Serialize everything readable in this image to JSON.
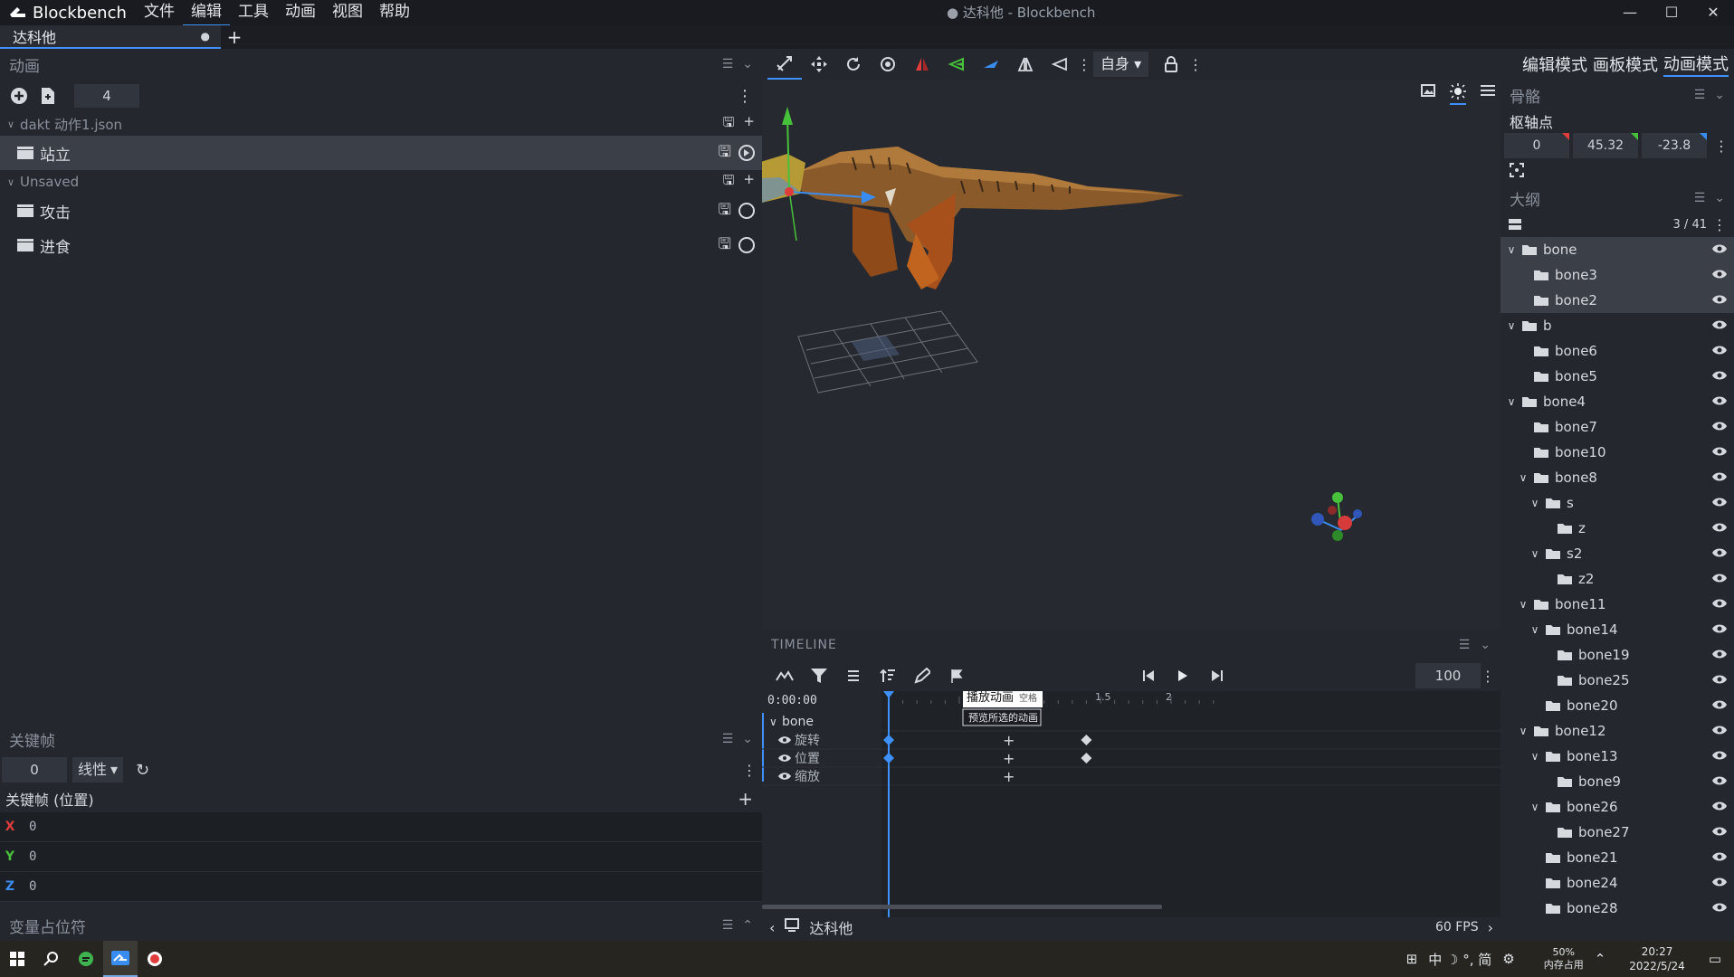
{
  "app": {
    "name": "Blockbench",
    "window_title": "● 达科他 - Blockbench",
    "menu": [
      "文件",
      "编辑",
      "工具",
      "动画",
      "视图",
      "帮助"
    ],
    "active_menu": "编辑",
    "tab_name": "达科他",
    "tab_dot": "●",
    "add_tab": "+",
    "minimize": "—",
    "maximize": "☐",
    "close": "✕"
  },
  "animations_panel": {
    "title": "动画",
    "count": "4",
    "file_group": "dakt 动作1.json",
    "unsaved_group": "Unsaved",
    "items": [
      {
        "label": "站立",
        "group": "file",
        "selected": true,
        "playing": true
      },
      {
        "label": "攻击",
        "group": "unsaved",
        "selected": false,
        "playing": false
      },
      {
        "label": "进食",
        "group": "unsaved",
        "selected": false,
        "playing": false
      }
    ]
  },
  "keyframe_panel": {
    "title": "关键帧",
    "time_value": "0",
    "interpolation": "线性",
    "section_title": "关键帧 (位置)",
    "axes": [
      {
        "axis": "X",
        "value": "0",
        "color": "#e03c3c"
      },
      {
        "axis": "Y",
        "value": "0",
        "color": "#47c13b"
      },
      {
        "axis": "Z",
        "value": "0",
        "color": "#3a8df0"
      }
    ]
  },
  "variables_panel": {
    "title": "变量占位符"
  },
  "viewport": {
    "space_select": "自身"
  },
  "timeline": {
    "title": "TIMELINE",
    "current_time": "0:00:00",
    "fps_field": "100",
    "ruler_labels": [
      "1.5",
      "2"
    ],
    "tooltip_title": "播放动画",
    "tooltip_key": "空格",
    "tooltip_desc": "预览所选的动画",
    "bone": "bone",
    "channels": [
      {
        "label": "旋转",
        "keyframes": [
          0,
          1.4
        ]
      },
      {
        "label": "位置",
        "keyframes": [
          0,
          1.4
        ]
      },
      {
        "label": "缩放",
        "keyframes": []
      }
    ],
    "animation_name": "达科他",
    "fps_label": "60 FPS"
  },
  "right_panel": {
    "modes": [
      "编辑模式",
      "画板模式",
      "动画模式"
    ],
    "active_mode": "动画模式",
    "bones_title": "骨骼",
    "pivot_label": "枢轴点",
    "pivot": [
      "0",
      "45.32",
      "-23.8"
    ],
    "outliner_title": "大纲",
    "outliner_count": "3 / 41",
    "tree": [
      {
        "name": "bone",
        "depth": 0,
        "expanded": true,
        "selected": true
      },
      {
        "name": "bone3",
        "depth": 1,
        "expanded": null,
        "selected": true
      },
      {
        "name": "bone2",
        "depth": 1,
        "expanded": null,
        "selected": true
      },
      {
        "name": "b",
        "depth": 0,
        "expanded": true,
        "selected": false
      },
      {
        "name": "bone6",
        "depth": 1,
        "expanded": null,
        "selected": false
      },
      {
        "name": "bone5",
        "depth": 1,
        "expanded": null,
        "selected": false
      },
      {
        "name": "bone4",
        "depth": 0,
        "expanded": true,
        "selected": false
      },
      {
        "name": "bone7",
        "depth": 1,
        "expanded": null,
        "selected": false
      },
      {
        "name": "bone10",
        "depth": 1,
        "expanded": null,
        "selected": false
      },
      {
        "name": "bone8",
        "depth": 1,
        "expanded": true,
        "selected": false
      },
      {
        "name": "s",
        "depth": 2,
        "expanded": true,
        "selected": false
      },
      {
        "name": "z",
        "depth": 3,
        "expanded": null,
        "selected": false
      },
      {
        "name": "s2",
        "depth": 2,
        "expanded": true,
        "selected": false
      },
      {
        "name": "z2",
        "depth": 3,
        "expanded": null,
        "selected": false
      },
      {
        "name": "bone11",
        "depth": 1,
        "expanded": true,
        "selected": false
      },
      {
        "name": "bone14",
        "depth": 2,
        "expanded": true,
        "selected": false
      },
      {
        "name": "bone19",
        "depth": 3,
        "expanded": null,
        "selected": false
      },
      {
        "name": "bone25",
        "depth": 3,
        "expanded": null,
        "selected": false
      },
      {
        "name": "bone20",
        "depth": 2,
        "expanded": null,
        "selected": false
      },
      {
        "name": "bone12",
        "depth": 1,
        "expanded": true,
        "selected": false
      },
      {
        "name": "bone13",
        "depth": 2,
        "expanded": true,
        "selected": false
      },
      {
        "name": "bone9",
        "depth": 3,
        "expanded": null,
        "selected": false
      },
      {
        "name": "bone26",
        "depth": 2,
        "expanded": true,
        "selected": false
      },
      {
        "name": "bone27",
        "depth": 3,
        "expanded": null,
        "selected": false
      },
      {
        "name": "bone21",
        "depth": 2,
        "expanded": null,
        "selected": false
      },
      {
        "name": "bone24",
        "depth": 2,
        "expanded": null,
        "selected": false
      },
      {
        "name": "bone28",
        "depth": 2,
        "expanded": null,
        "selected": false
      }
    ]
  },
  "taskbar": {
    "tray_text": "中 ☽ °, 简",
    "memory_percent": "50%",
    "memory_label": "内存占用",
    "time": "20:27",
    "date": "2022/5/24"
  },
  "colors": {
    "accent": "#3e90ff",
    "x_axis": "#e03c3c",
    "y_axis": "#47c13b",
    "z_axis": "#3a8df0"
  }
}
